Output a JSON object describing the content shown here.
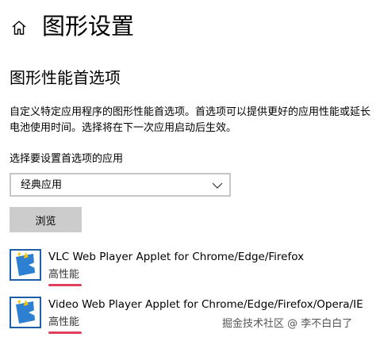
{
  "header": {
    "home_icon": "home-icon",
    "title": "图形设置"
  },
  "section": {
    "title": "图形性能首选项",
    "description": "自定义特定应用程序的图形性能首选项。首选项可以提供更好的应用性能或延长电池使用时间。选择将在下一次应用启动后生效。"
  },
  "app_select": {
    "label": "选择要设置首选项的应用",
    "value": "经典应用",
    "chevron_icon": "chevron-down-icon"
  },
  "browse_button": {
    "label": "浏览"
  },
  "apps": [
    {
      "name": "VLC Web Player Applet for Chrome/Edge/Firefox",
      "preference": "高性能",
      "icon": "app-icon"
    },
    {
      "name": "Video Web Player Applet for Chrome/Edge/Firefox/Opera/IE",
      "preference": "高性能",
      "icon": "app-icon"
    }
  ],
  "watermark": "掘金技术社区 @ 李不白白了",
  "colors": {
    "underline": "#e0405d",
    "button_bg": "#cccccc",
    "icon_border": "#1f5fa8"
  }
}
